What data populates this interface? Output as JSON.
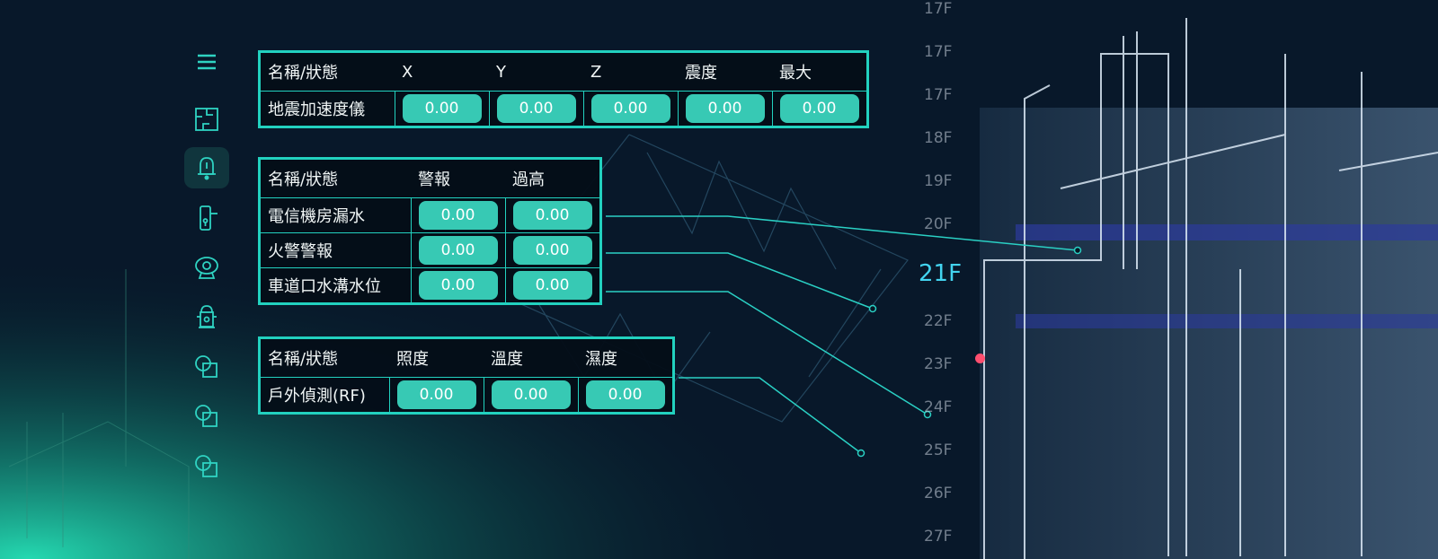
{
  "colors": {
    "accent": "#22d1bf",
    "value_button": "#37c9b4",
    "current_floor": "#43d4f0",
    "alert_dot": "#ff4f6f"
  },
  "sidebar": {
    "items": [
      {
        "icon": "menu-icon",
        "active": false
      },
      {
        "icon": "floorplan-icon",
        "active": false
      },
      {
        "icon": "bell-icon",
        "active": true
      },
      {
        "icon": "door-lock-icon",
        "active": false
      },
      {
        "icon": "camera-icon",
        "active": false
      },
      {
        "icon": "fire-hydrant-icon",
        "active": false
      },
      {
        "icon": "shape-icon",
        "active": false
      },
      {
        "icon": "shape-icon",
        "active": false
      },
      {
        "icon": "shape-icon",
        "active": false
      }
    ]
  },
  "seismic": {
    "headers": [
      "名稱/狀態",
      "X",
      "Y",
      "Z",
      "震度",
      "最大"
    ],
    "rows": [
      {
        "label": "地震加速度儀",
        "values": [
          "0.00",
          "0.00",
          "0.00",
          "0.00",
          "0.00"
        ]
      }
    ]
  },
  "alarms": {
    "headers": [
      "名稱/狀態",
      "警報",
      "過高"
    ],
    "rows": [
      {
        "label": "電信機房漏水",
        "values": [
          "0.00",
          "0.00"
        ]
      },
      {
        "label": "火警警報",
        "values": [
          "0.00",
          "0.00"
        ]
      },
      {
        "label": "車道口水溝水位",
        "values": [
          "0.00",
          "0.00"
        ]
      }
    ]
  },
  "environment": {
    "headers": [
      "名稱/狀態",
      "照度",
      "溫度",
      "濕度"
    ],
    "rows": [
      {
        "label": "戶外偵測(RF)",
        "values": [
          "0.00",
          "0.00",
          "0.00"
        ]
      }
    ]
  },
  "floors": {
    "list": [
      "17F",
      "17F",
      "17F",
      "18F",
      "19F",
      "20F",
      "21F",
      "22F",
      "23F",
      "24F",
      "25F",
      "26F",
      "27F"
    ],
    "current": "21F"
  }
}
